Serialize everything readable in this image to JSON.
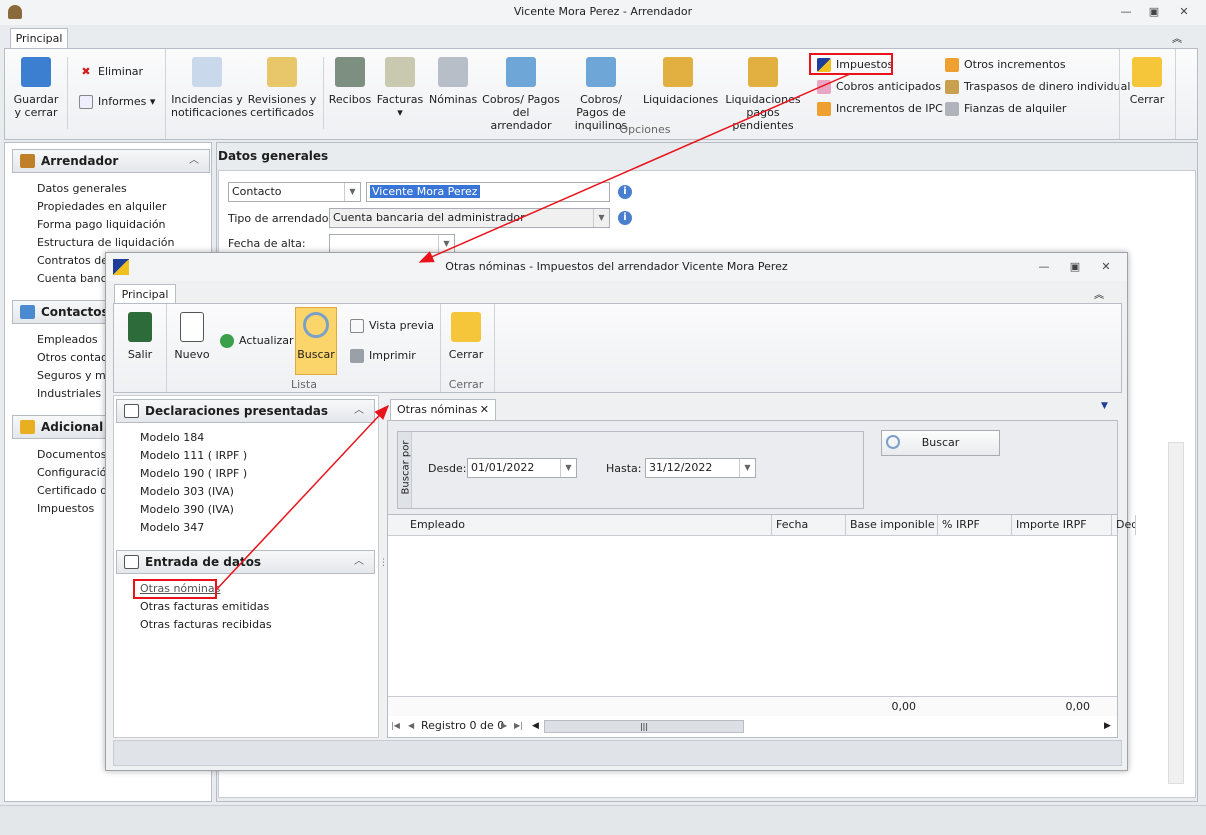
{
  "window": {
    "title": "Vicente Mora Perez - Arrendador",
    "tab": "Principal"
  },
  "ribbon": {
    "guardar": "Guardar\ny cerrar",
    "eliminar": "Eliminar",
    "informes": "Informes",
    "incidencias": "Incidencias y notificaciones",
    "revisiones": "Revisiones y certificados",
    "recibos": "Recibos",
    "facturas": "Facturas",
    "nominas": "Nóminas",
    "cobros_arr": "Cobros/ Pagos del arrendador",
    "cobros_inq": "Cobros/ Pagos de inquilinos",
    "liquidaciones": "Liquidaciones",
    "liq_pend": "Liquidaciones pagos pendientes",
    "impuestos": "Impuestos",
    "cobros_ant": "Cobros anticipados",
    "incr_ipc": "Incrementos de IPC",
    "otros_incr": "Otros incrementos",
    "traspasos": "Traspasos de dinero individual",
    "fianzas": "Fianzas de alquiler",
    "cerrar": "Cerrar",
    "group_opciones": "Opciones"
  },
  "sidebar": {
    "arrendador": {
      "title": "Arrendador",
      "items": [
        "Datos generales",
        "Propiedades en alquiler",
        "Forma pago liquidación",
        "Estructura de liquidación",
        "Contratos de",
        "Cuenta banca"
      ]
    },
    "contactos": {
      "title": "Contactos e",
      "items": [
        "Empleados",
        "Otros contact",
        "Seguros y mar",
        "Industriales"
      ]
    },
    "adicional": {
      "title": "Adicional",
      "items": [
        "Documentos",
        "Configuración",
        "Certificado dig",
        "Impuestos"
      ]
    }
  },
  "content": {
    "title": "Datos generales",
    "contacto_select": "Contacto",
    "contacto_value": "Vicente Mora Perez",
    "tipo_label": "Tipo de arrendador:",
    "tipo_value": "Cuenta bancaria del administrador",
    "fecha_label": "Fecha de alta:",
    "fecha_value": ""
  },
  "dialog": {
    "title": "Otras nóminas - Impuestos del arrendador Vicente Mora Perez",
    "tab": "Principal",
    "ribbon": {
      "salir": "Salir",
      "nuevo": "Nuevo",
      "actualizar": "Actualizar",
      "buscar": "Buscar",
      "vista_previa": "Vista previa",
      "imprimir": "Imprimir",
      "cerrar": "Cerrar",
      "group_lista": "Lista",
      "group_cerrar": "Cerrar"
    },
    "left": {
      "declaraciones": {
        "title": "Declaraciones presentadas",
        "items": [
          "Modelo 184",
          "Modelo 111 ( IRPF )",
          "Modelo 190 ( IRPF )",
          "Modelo 303 (IVA)",
          "Modelo 390 (IVA)",
          "Modelo 347"
        ]
      },
      "entrada": {
        "title": "Entrada de datos",
        "items": [
          "Otras nóminas",
          "Otras facturas emitidas",
          "Otras facturas recibidas"
        ]
      }
    },
    "doc_tab": "Otras nóminas",
    "search": {
      "group_label": "Buscar por",
      "desde_label": "Desde:",
      "desde": "01/01/2022",
      "hasta_label": "Hasta:",
      "hasta": "31/12/2022",
      "button": "Buscar"
    },
    "grid": {
      "columns": [
        "Empleado",
        "Fecha",
        "Base imponible",
        "% IRPF",
        "Importe IRPF",
        "Ded"
      ],
      "total_base": "0,00",
      "total_importe": "0,00",
      "nav": "Registro 0 de 0"
    }
  },
  "colors": {
    "annotation": "#e8131b",
    "selection": "#3875d7"
  }
}
